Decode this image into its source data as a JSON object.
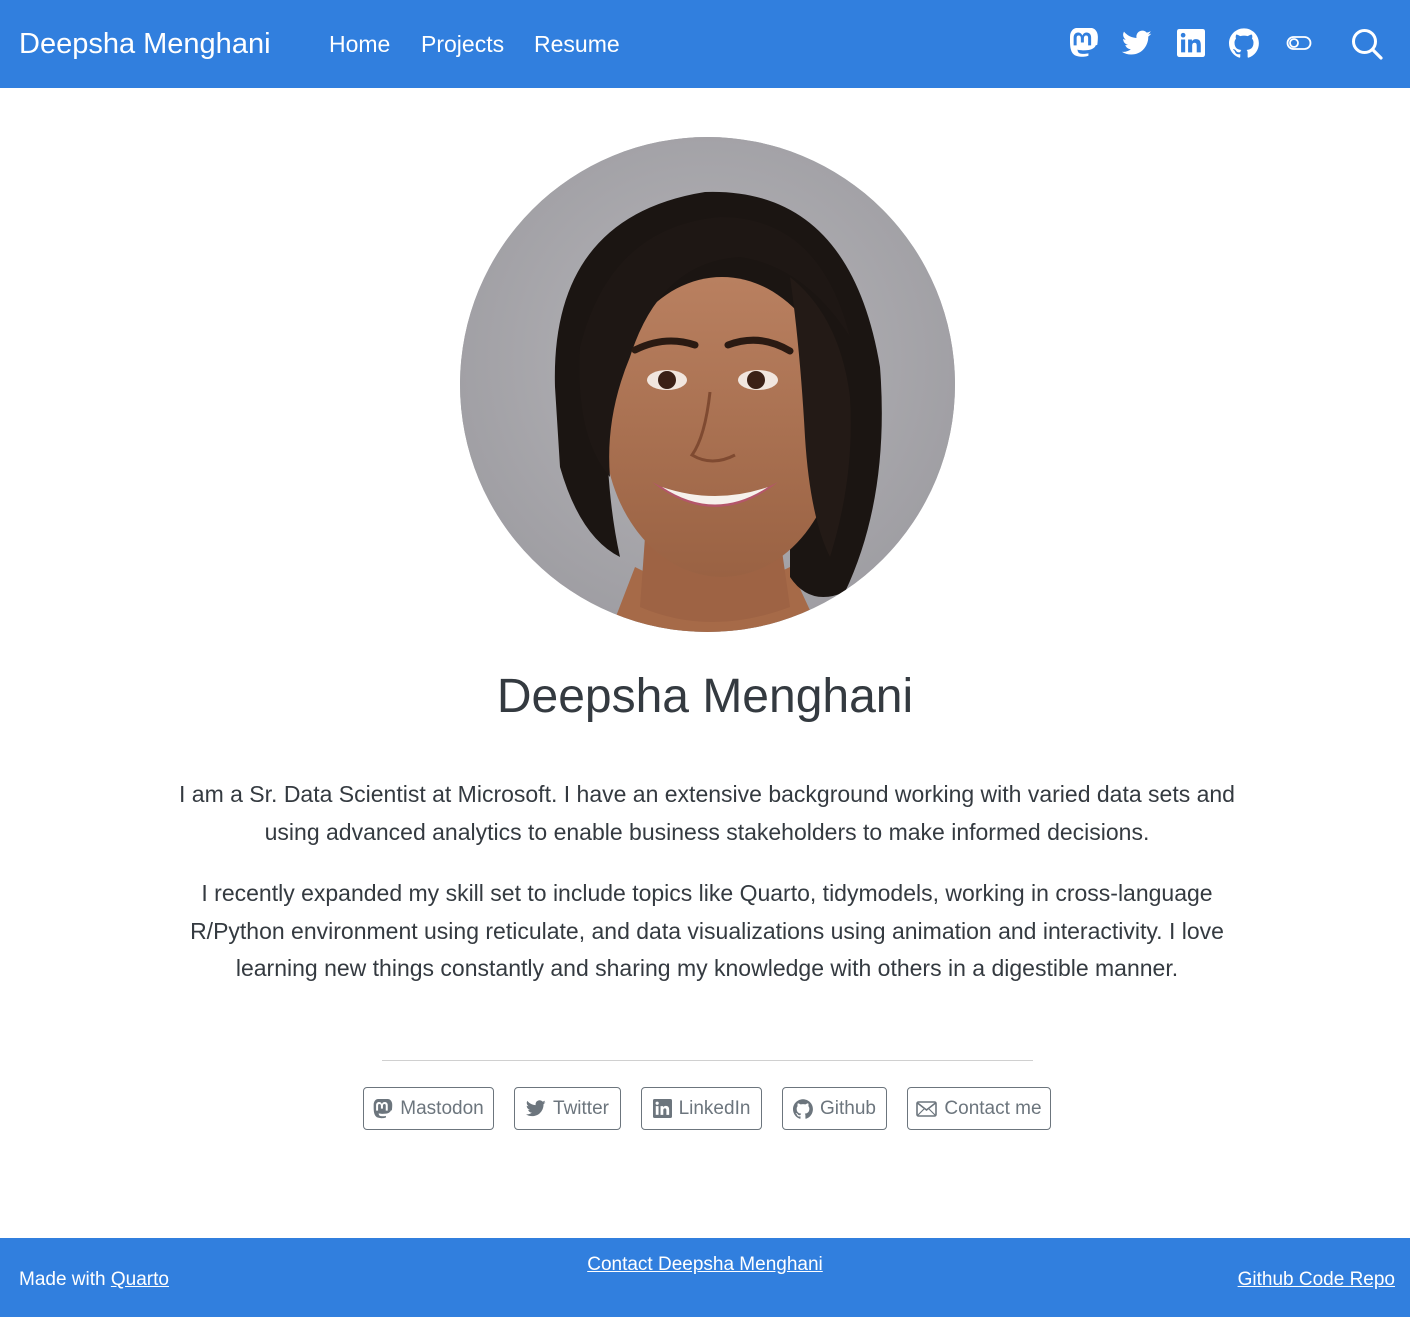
{
  "navbar": {
    "brand": "Deepsha Menghani",
    "links": [
      {
        "label": "Home"
      },
      {
        "label": "Projects"
      },
      {
        "label": "Resume"
      }
    ],
    "icons": [
      "mastodon-icon",
      "twitter-icon",
      "linkedin-icon",
      "github-icon",
      "toggle-icon",
      "search-icon"
    ]
  },
  "profile": {
    "name": "Deepsha Menghani",
    "bio": [
      "I am a Sr. Data Scientist at Microsoft. I have an extensive background working with varied data sets and using advanced analytics to enable business stakeholders to make informed decisions.",
      "I recently expanded my skill set to include topics like Quarto, tidymodels, working in cross-language R/Python environment using reticulate, and data visualizations using animation and interactivity. I love learning new things constantly and sharing my knowledge with others in a digestible manner."
    ]
  },
  "social_buttons": [
    {
      "label": "Mastodon",
      "icon": "mastodon-icon"
    },
    {
      "label": "Twitter",
      "icon": "twitter-icon"
    },
    {
      "label": "LinkedIn",
      "icon": "linkedin-icon"
    },
    {
      "label": "Github",
      "icon": "github-icon"
    },
    {
      "label": "Contact me",
      "icon": "envelope-icon"
    }
  ],
  "footer": {
    "left_prefix": "Made with ",
    "left_link": "Quarto",
    "center_link": "Contact Deepsha Menghani",
    "right_link": "Github Code Repo"
  },
  "colors": {
    "brand_blue": "#317fde",
    "text": "#343a40",
    "button_border": "#6c757d"
  }
}
